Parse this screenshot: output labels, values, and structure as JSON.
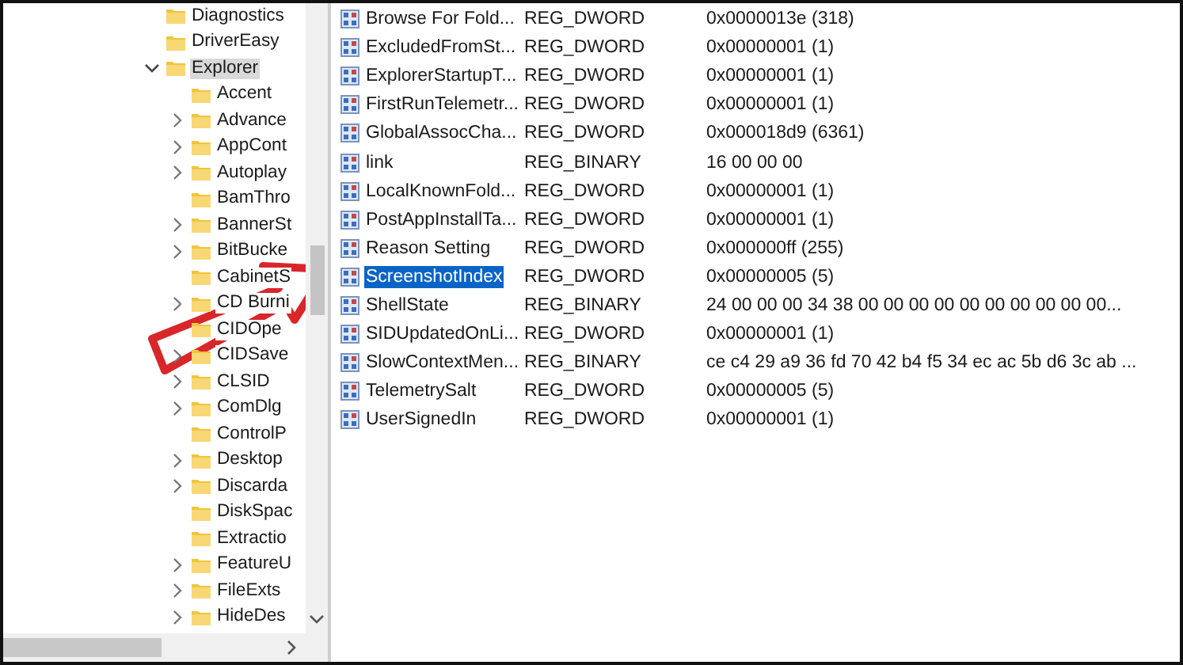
{
  "tree": {
    "items": [
      {
        "label": "Diagnostics",
        "kind": "leaf",
        "selected": false
      },
      {
        "label": "DriverEasy",
        "kind": "leaf",
        "selected": false
      },
      {
        "label": "Explorer",
        "kind": "expanded",
        "selected": true,
        "children": [
          {
            "label": "Accent",
            "kind": "leaf",
            "selected": false
          },
          {
            "label": "Advance",
            "kind": "collapsed",
            "selected": false
          },
          {
            "label": "AppCont",
            "kind": "collapsed",
            "selected": false
          },
          {
            "label": "Autoplay",
            "kind": "collapsed",
            "selected": false
          },
          {
            "label": "BamThro",
            "kind": "leaf",
            "selected": false
          },
          {
            "label": "BannerSt",
            "kind": "collapsed",
            "selected": false
          },
          {
            "label": "BitBucke",
            "kind": "collapsed",
            "selected": false
          },
          {
            "label": "CabinetS",
            "kind": "leaf",
            "selected": false
          },
          {
            "label": "CD Burni",
            "kind": "collapsed",
            "selected": false
          },
          {
            "label": "CIDOpe",
            "kind": "leaf",
            "selected": false
          },
          {
            "label": "CIDSave",
            "kind": "collapsed",
            "selected": false
          },
          {
            "label": "CLSID",
            "kind": "collapsed",
            "selected": false
          },
          {
            "label": "ComDlg",
            "kind": "collapsed",
            "selected": false
          },
          {
            "label": "ControlP",
            "kind": "leaf",
            "selected": false
          },
          {
            "label": "Desktop",
            "kind": "collapsed",
            "selected": false
          },
          {
            "label": "Discarda",
            "kind": "collapsed",
            "selected": false
          },
          {
            "label": "DiskSpac",
            "kind": "leaf",
            "selected": false
          },
          {
            "label": "Extractio",
            "kind": "leaf",
            "selected": false
          },
          {
            "label": "FeatureU",
            "kind": "collapsed",
            "selected": false
          },
          {
            "label": "FileExts",
            "kind": "collapsed",
            "selected": false
          },
          {
            "label": "HideDes",
            "kind": "collapsed",
            "selected": false
          }
        ]
      }
    ]
  },
  "values": {
    "rows": [
      {
        "name": "Browse For Fold...",
        "type": "REG_DWORD",
        "data": "0x0000013e (318)",
        "selected": false
      },
      {
        "name": "ExcludedFromSt...",
        "type": "REG_DWORD",
        "data": "0x00000001 (1)",
        "selected": false
      },
      {
        "name": "ExplorerStartupT...",
        "type": "REG_DWORD",
        "data": "0x00000001 (1)",
        "selected": false
      },
      {
        "name": "FirstRunTelemetr...",
        "type": "REG_DWORD",
        "data": "0x00000001 (1)",
        "selected": false
      },
      {
        "name": "GlobalAssocCha...",
        "type": "REG_DWORD",
        "data": "0x000018d9 (6361)",
        "selected": false
      },
      {
        "name": "link",
        "type": "REG_BINARY",
        "data": "16 00 00 00",
        "selected": false
      },
      {
        "name": "LocalKnownFold...",
        "type": "REG_DWORD",
        "data": "0x00000001 (1)",
        "selected": false
      },
      {
        "name": "PostAppInstallTa...",
        "type": "REG_DWORD",
        "data": "0x00000001 (1)",
        "selected": false
      },
      {
        "name": "Reason Setting",
        "type": "REG_DWORD",
        "data": "0x000000ff (255)",
        "selected": false
      },
      {
        "name": "ScreenshotIndex",
        "type": "REG_DWORD",
        "data": "0x00000005 (5)",
        "selected": true
      },
      {
        "name": "ShellState",
        "type": "REG_BINARY",
        "data": "24 00 00 00 34 38 00 00 00 00 00 00 00 00 00 00...",
        "selected": false
      },
      {
        "name": "SIDUpdatedOnLi...",
        "type": "REG_DWORD",
        "data": "0x00000001 (1)",
        "selected": false
      },
      {
        "name": "SlowContextMen...",
        "type": "REG_BINARY",
        "data": "ce c4 29 a9 36 fd 70 42 b4 f5 34 ec ac 5b d6 3c ab ...",
        "selected": false
      },
      {
        "name": "TelemetrySalt",
        "type": "REG_DWORD",
        "data": "0x00000005 (5)",
        "selected": false
      },
      {
        "name": "UserSignedIn",
        "type": "REG_DWORD",
        "data": "0x00000001 (1)",
        "selected": false
      }
    ]
  }
}
